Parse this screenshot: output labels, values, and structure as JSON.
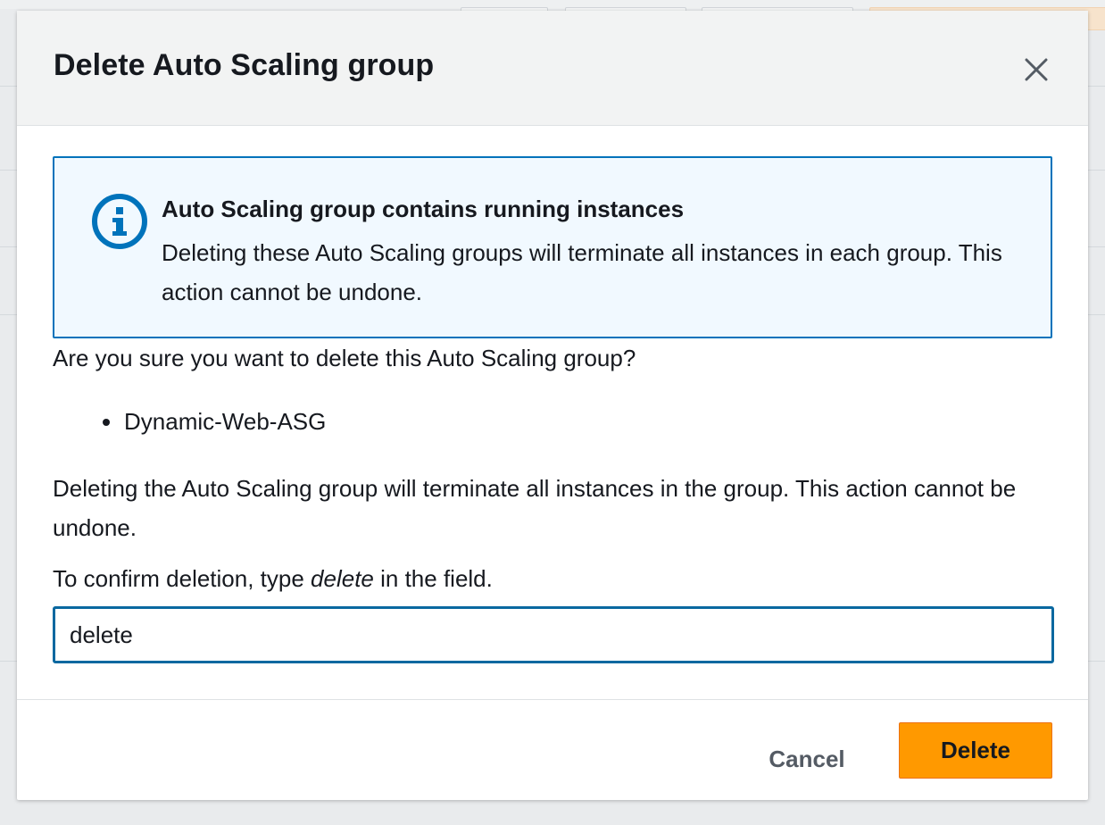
{
  "modal": {
    "title": "Delete Auto Scaling group",
    "close_icon": "close-icon"
  },
  "alert": {
    "icon": "info-icon",
    "title": "Auto Scaling group contains running instances",
    "text": "Deleting these Auto Scaling groups will terminate all instances in each group. This action cannot be undone."
  },
  "question": "Are you sure you want to delete this Auto Scaling group?",
  "groups": [
    "Dynamic-Web-ASG"
  ],
  "warning": "Deleting the Auto Scaling group will terminate all instances in the group. This action cannot be undone.",
  "confirm": {
    "prefix": "To confirm deletion, type ",
    "keyword": "delete",
    "suffix": " in the field.",
    "input_value": "delete"
  },
  "footer": {
    "cancel_label": "Cancel",
    "delete_label": "Delete"
  },
  "colors": {
    "accent": "#ff9900",
    "info_border": "#0073bb",
    "info_bg": "#f1f9ff"
  }
}
